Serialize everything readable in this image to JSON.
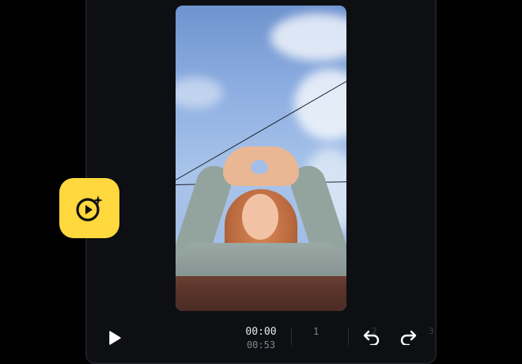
{
  "app": {
    "name": "video-editor",
    "accent": "#ffd83d",
    "icon": "sparkle-play-icon"
  },
  "preview": {
    "content": "photo"
  },
  "player": {
    "current_time": "00:00",
    "total_time": "00:53",
    "play_icon": "play-icon"
  },
  "toolbar": {
    "counter": "1",
    "faded_left": "2",
    "faded_right": "3",
    "undo_icon": "undo-icon",
    "redo_icon": "redo-icon"
  }
}
